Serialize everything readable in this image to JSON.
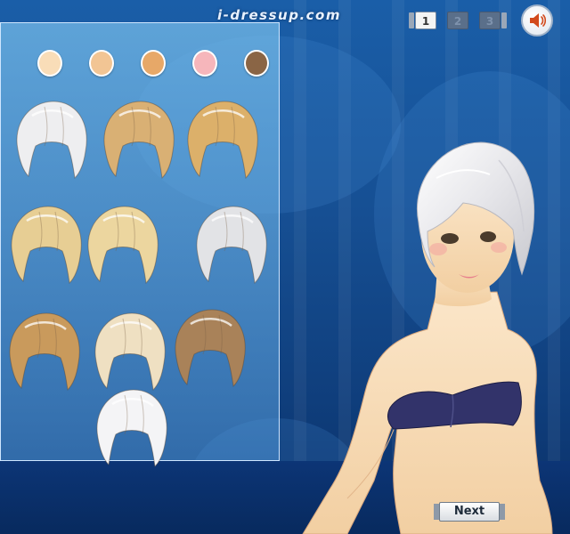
{
  "header": {
    "site_name": "i-dressup.com",
    "pages": [
      {
        "label": "1",
        "active": true
      },
      {
        "label": "2",
        "active": false
      },
      {
        "label": "3",
        "active": false
      }
    ],
    "sound_icon": "speaker-icon"
  },
  "panel": {
    "skin_tones": [
      "#f9ddb8",
      "#f2c594",
      "#e7a868",
      "#f6b6bb",
      "#8a6545"
    ],
    "hairstyles": [
      {
        "name": "hair-short-platinum-bob",
        "color": "#eeeef0"
      },
      {
        "name": "hair-side-swept-honey-bob",
        "color": "#d9b074"
      },
      {
        "name": "hair-golden-blunt-bob",
        "color": "#dcb06a"
      },
      {
        "name": "hair-wavy-blonde-shag",
        "color": "#e7ce94"
      },
      {
        "name": "hair-curly-blonde-bob",
        "color": "#ecd69f"
      },
      {
        "name": "hair-silver-choppy",
        "color": "#e2e3e6"
      },
      {
        "name": "hair-long-caramel-bob",
        "color": "#c99a5c"
      },
      {
        "name": "hair-two-tone-pageboy",
        "color": "#efe0c2"
      },
      {
        "name": "hair-ash-brown-bob",
        "color": "#a98259"
      },
      {
        "name": "hair-white-mushroom",
        "color": "#f4f4f6"
      }
    ]
  },
  "model": {
    "skin": "#f9e0bf",
    "hair": "#ecebee",
    "top": "#32336a"
  },
  "footer": {
    "next_label": "Next"
  }
}
